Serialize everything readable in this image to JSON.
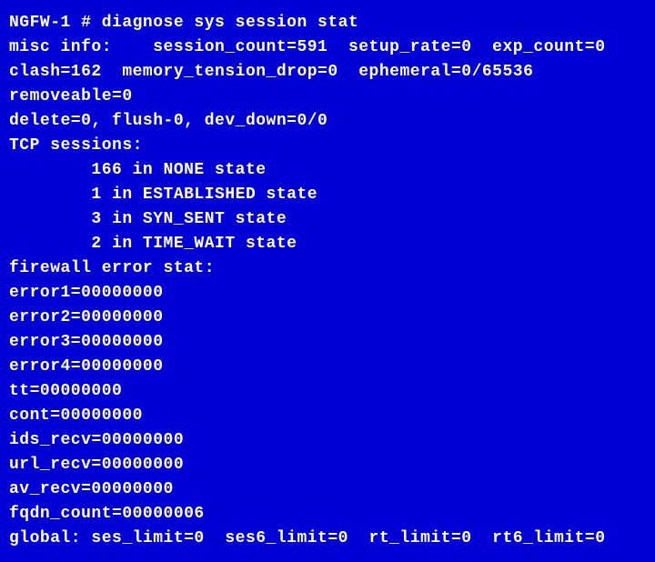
{
  "terminal": {
    "lines": [
      "NGFW-1 # diagnose sys session stat",
      "misc info:    session_count=591  setup_rate=0  exp_count=0",
      "clash=162  memory_tension_drop=0  ephemeral=0/65536",
      "removeable=0",
      "delete=0, flush-0, dev_down=0/0",
      "TCP sessions:",
      "        166 in NONE state",
      "        1 in ESTABLISHED state",
      "        3 in SYN_SENT state",
      "        2 in TIME_WAIT state",
      "firewall error stat:",
      "error1=00000000",
      "error2=00000000",
      "error3=00000000",
      "error4=00000000",
      "tt=00000000",
      "cont=00000000",
      "ids_recv=00000000",
      "url_recv=00000000",
      "av_recv=00000000",
      "fqdn_count=00000006",
      "global: ses_limit=0  ses6_limit=0  rt_limit=0  rt6_limit=0"
    ]
  }
}
